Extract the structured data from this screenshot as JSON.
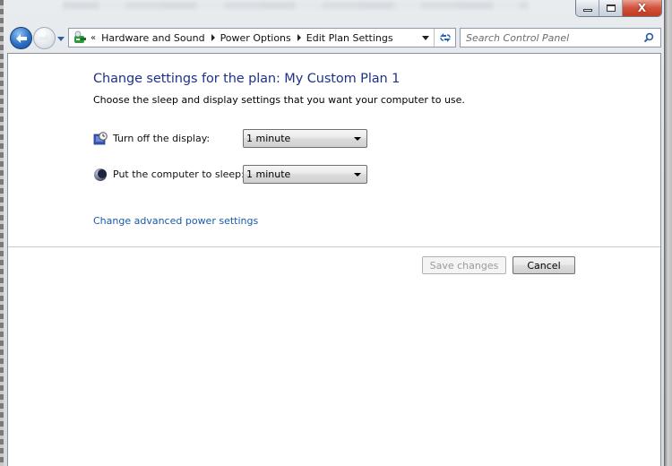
{
  "window": {
    "caption_buttons": {
      "minimize": "minimize",
      "maximize": "maximize",
      "close": "X"
    }
  },
  "navigation": {
    "back_label": "Back",
    "forward_label": "Forward",
    "recent_pages_label": "Recent pages",
    "breadcrumb_overflow": "«",
    "breadcrumb": [
      {
        "label": "Hardware and Sound"
      },
      {
        "label": "Power Options"
      },
      {
        "label": "Edit Plan Settings"
      }
    ],
    "refresh_icon": "refresh-icon",
    "search": {
      "placeholder": "Search Control Panel",
      "value": ""
    }
  },
  "page": {
    "title": "Change settings for the plan: My Custom Plan 1",
    "subtitle": "Choose the sleep and display settings that you want your computer to use.",
    "settings": [
      {
        "icon": "display-clock-icon",
        "label": "Turn off the display:",
        "value": "1 minute"
      },
      {
        "icon": "sleep-moon-icon",
        "label": "Put the computer to sleep:",
        "value": "1 minute"
      }
    ],
    "advanced_link": "Change advanced power settings",
    "buttons": {
      "save": "Save changes",
      "cancel": "Cancel"
    }
  },
  "colors": {
    "title": "#1e3287",
    "link": "#1a5aa8",
    "close_button": "#d2503a",
    "disabled_text": "#9a9a9a"
  }
}
